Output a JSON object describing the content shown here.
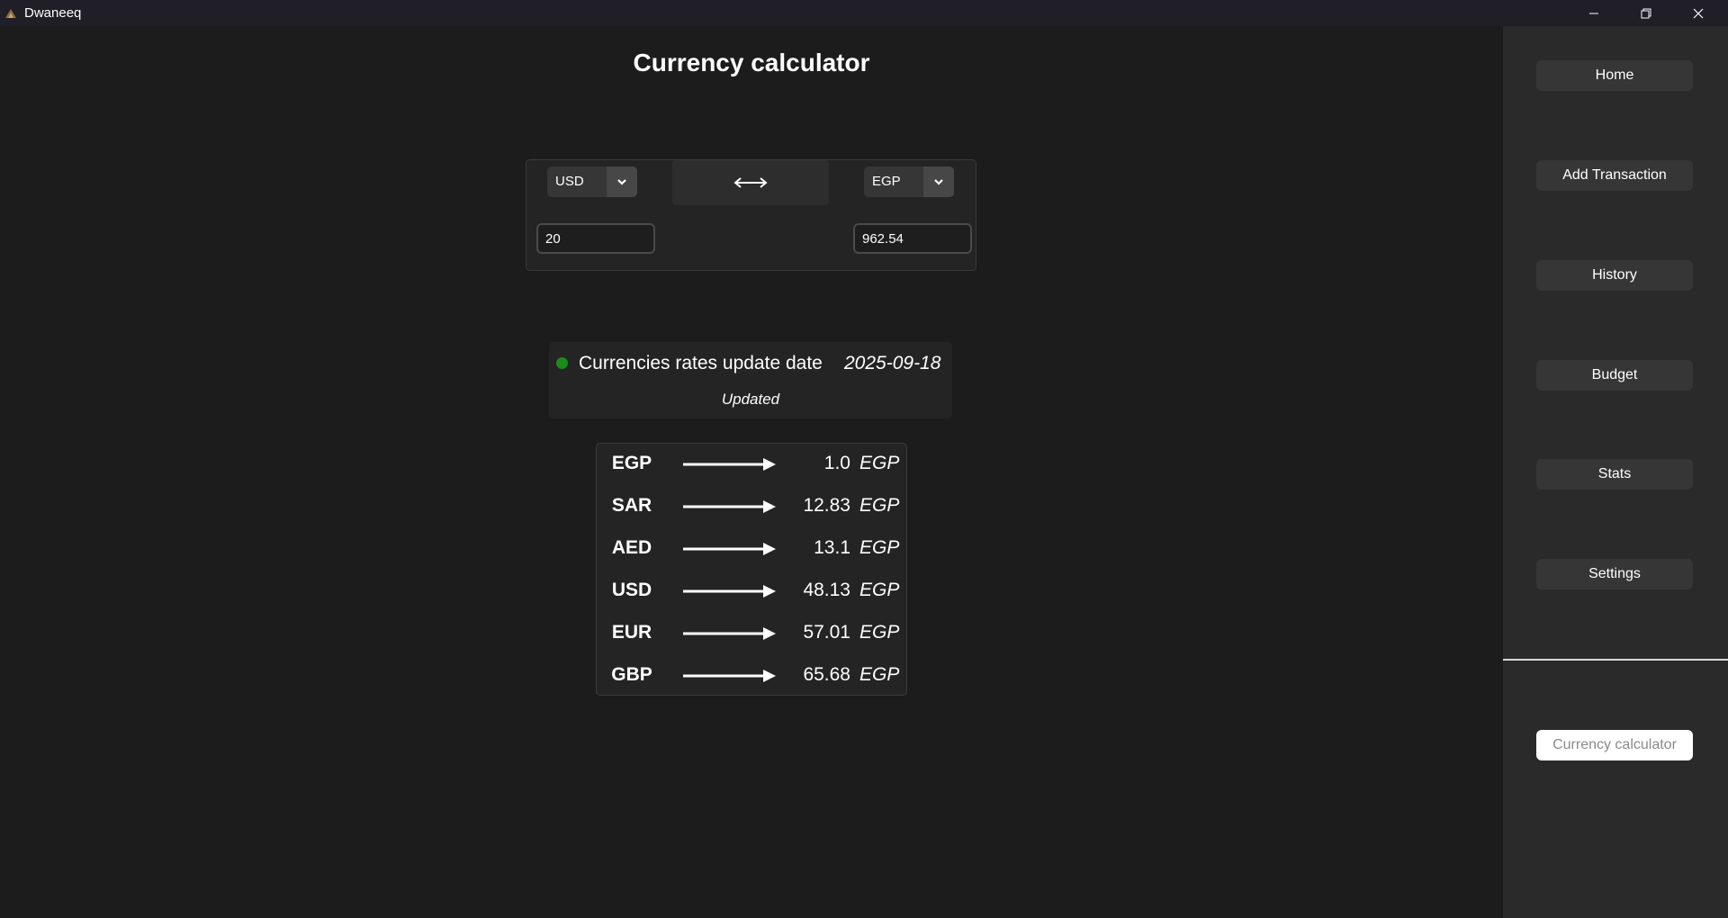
{
  "window": {
    "title": "Dwaneeq",
    "controls": [
      "minimize-icon",
      "restore-icon",
      "close-icon"
    ]
  },
  "main": {
    "title": "Currency calculator",
    "converter": {
      "from_currency": "USD",
      "to_currency": "EGP",
      "from_amount": "20",
      "to_amount": "962.54",
      "swap_icon": "left-right-arrow-icon"
    },
    "status": {
      "indicator_color": "#1a8a1a",
      "label": "Currencies rates update date",
      "date": "2025-09-18",
      "state": "Updated"
    },
    "rates": [
      {
        "code": "EGP",
        "value": "1.0",
        "unit": "EGP"
      },
      {
        "code": "SAR",
        "value": "12.83",
        "unit": "EGP"
      },
      {
        "code": "AED",
        "value": "13.1",
        "unit": "EGP"
      },
      {
        "code": "USD",
        "value": "48.13",
        "unit": "EGP"
      },
      {
        "code": "EUR",
        "value": "57.01",
        "unit": "EGP"
      },
      {
        "code": "GBP",
        "value": "65.68",
        "unit": "EGP"
      }
    ]
  },
  "sidebar": {
    "items": [
      {
        "label": "Home"
      },
      {
        "label": "Add Transaction"
      },
      {
        "label": "History"
      },
      {
        "label": "Budget"
      },
      {
        "label": "Stats"
      },
      {
        "label": "Settings"
      }
    ],
    "active_item": {
      "label": "Currency calculator"
    }
  }
}
